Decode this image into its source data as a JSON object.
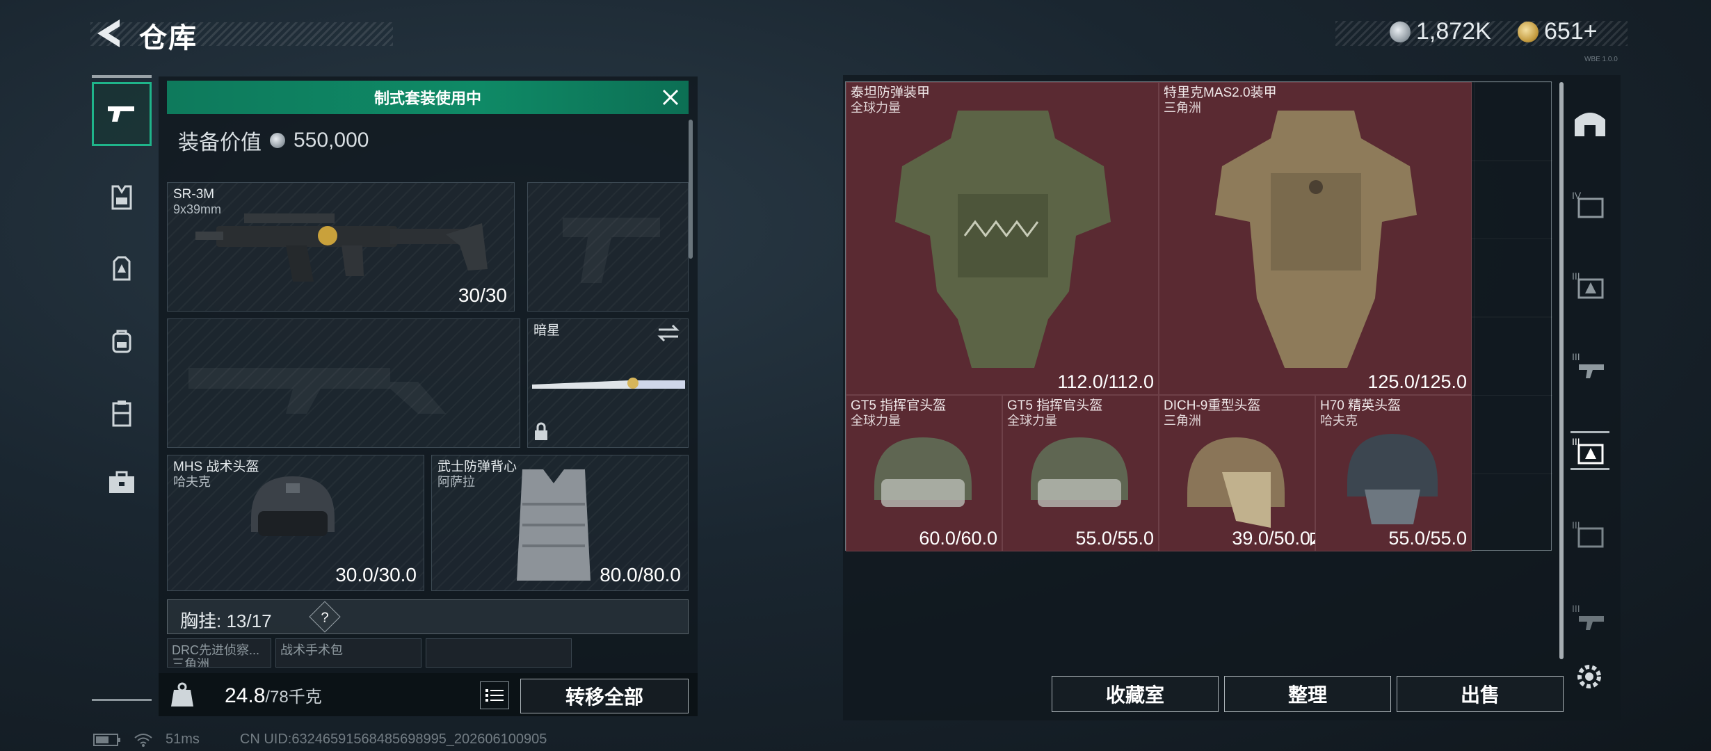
{
  "header": {
    "title": "仓库",
    "currencies": [
      {
        "name": "silver-coin",
        "value": "1,872K"
      },
      {
        "name": "gold-coin",
        "value": "651+"
      }
    ],
    "code_text": "WBE 1.0.0"
  },
  "left_nav": {
    "items": [
      {
        "name": "pistol-icon",
        "active": true
      },
      {
        "name": "vest-icon",
        "active": false
      },
      {
        "name": "chest-rig-icon",
        "active": false
      },
      {
        "name": "backpack-icon",
        "active": false
      },
      {
        "name": "case-icon",
        "active": false
      },
      {
        "name": "briefcase-icon",
        "active": false
      }
    ]
  },
  "loadout": {
    "banner": "制式套装使用中",
    "equip_value_label": "装备价值",
    "equip_value": "550,000",
    "primary_weapon": {
      "name": "SR-3M",
      "caliber": "9x39mm",
      "ammo": "30/30"
    },
    "melee": {
      "name": "暗星"
    },
    "helmet": {
      "name": "MHS 战术头盔",
      "brand": "哈夫克",
      "durability": "30.0/30.0"
    },
    "armor": {
      "name": "武士防弹背心",
      "brand": "阿萨拉",
      "durability": "80.0/80.0"
    },
    "chest_rig_label": "胸挂:",
    "chest_rig_value": "13/17",
    "help_symbol": "?",
    "mini_items": [
      "DRC先进侦察...",
      "战术手术包",
      ""
    ],
    "mini_items_sub": [
      "三角洲"
    ],
    "weight": "24.8",
    "weight_max": "/78千克",
    "transfer_all": "转移全部"
  },
  "storage": {
    "items": [
      {
        "name": "泰坦防弹装甲",
        "brand": "全球力量",
        "durability": "112.0/112.0"
      },
      {
        "name": "特里克MAS2.0装甲",
        "brand": "三角洲",
        "durability": "125.0/125.0"
      },
      {
        "name": "GT5 指挥官头盔",
        "brand": "全球力量",
        "durability": "60.0/60.0"
      },
      {
        "name": "GT5 指挥官头盔",
        "brand": "全球力量",
        "durability": "55.0/55.0"
      },
      {
        "name": "DICH-9重型头盔",
        "brand": "三角洲",
        "durability": "39.0/50.0"
      },
      {
        "name": "H70 精英头盔",
        "brand": "哈夫克",
        "durability": "55.0/55.0"
      }
    ],
    "buttons": {
      "collection": "收藏室",
      "sort": "整理",
      "sell": "出售"
    }
  },
  "status_bar": {
    "ping": "51ms",
    "uid": "CN UID:63246591568485698995_202606100905"
  },
  "colors": {
    "accent_green": "#0f8a66",
    "item_bg": "#5a2a32"
  }
}
